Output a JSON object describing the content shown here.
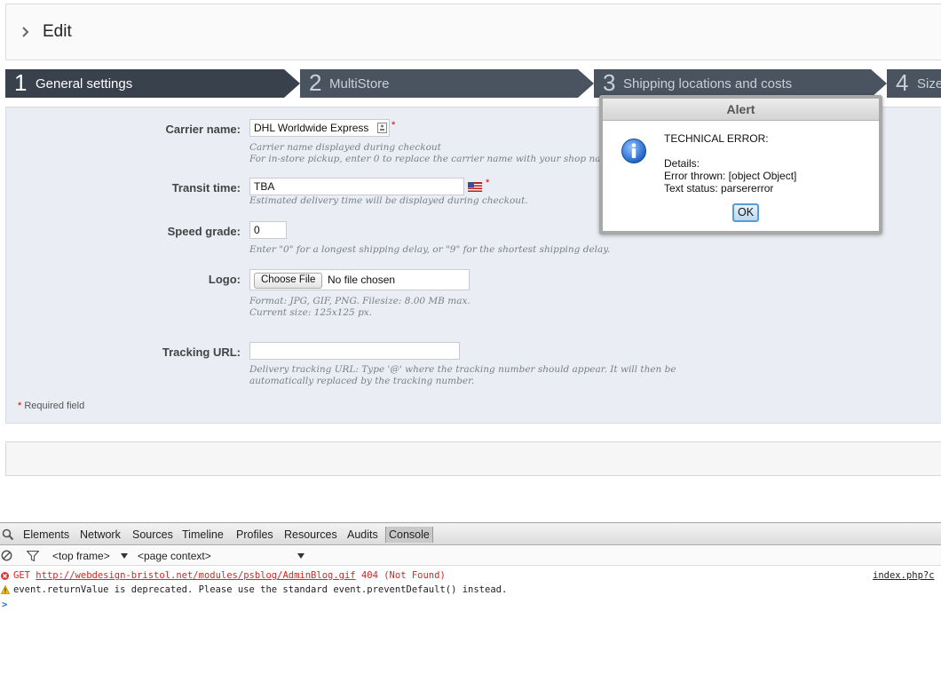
{
  "header": {
    "title": "Edit"
  },
  "steps": [
    {
      "num": "1",
      "label": "General settings"
    },
    {
      "num": "2",
      "label": "MultiStore"
    },
    {
      "num": "3",
      "label": "Shipping locations and costs"
    },
    {
      "num": "4",
      "label": "Size"
    }
  ],
  "form": {
    "carrier_name": {
      "label": "Carrier name:",
      "value": "DHL Worldwide Express",
      "hint": "Carrier name displayed during checkout\nFor in-store pickup, enter 0 to replace the carrier name with your shop name."
    },
    "transit_time": {
      "label": "Transit time:",
      "value": "TBA",
      "hint": "Estimated delivery time will be displayed during checkout."
    },
    "speed_grade": {
      "label": "Speed grade:",
      "value": "0",
      "hint": "Enter \"0\" for a longest shipping delay, or \"9\" for the shortest shipping delay."
    },
    "logo": {
      "label": "Logo:",
      "button": "Choose File",
      "file_text": "No file chosen",
      "hint": "Format: JPG, GIF, PNG. Filesize: 8.00 MB max.\nCurrent size: 125x125 px."
    },
    "tracking_url": {
      "label": "Tracking URL:",
      "value": "",
      "hint": "Delivery tracking URL: Type '@' where the tracking number should appear. It will then be\nautomatically replaced by the tracking number."
    },
    "required_note": "Required field",
    "required_star": "*"
  },
  "alert": {
    "title": "Alert",
    "message": "TECHNICAL ERROR:\n\nDetails:\nError thrown: [object Object]\nText status: parsererror",
    "ok_label": "OK"
  },
  "devtools": {
    "tabs": [
      "Elements",
      "Network",
      "Sources",
      "Timeline",
      "Profiles",
      "Resources",
      "Audits",
      "Console"
    ],
    "active_tab": "Console",
    "frame_select": "<top frame>",
    "context_select": "<page context>",
    "messages": [
      {
        "level": "error",
        "prefix": "GET ",
        "url": "http://webdesign-bristol.net/modules/psblog/AdminBlog.gif",
        "suffix": " 404 (Not Found)",
        "source": "index.php?c"
      },
      {
        "level": "warning",
        "text": "event.returnValue is deprecated. Please use the standard event.preventDefault() instead."
      }
    ],
    "prompt": ">"
  },
  "colors": {
    "step_active": "#39414c",
    "step_inactive": "#4a5460",
    "panel_bg": "#eaedf3",
    "required": "#dd0000",
    "error": "#dd2222"
  },
  "icons": [
    "chevron-right-icon",
    "translate-flag-icon",
    "info-icon",
    "search-icon",
    "clear-console-icon",
    "filter-icon",
    "error-icon",
    "warning-icon",
    "prompt-icon"
  ]
}
